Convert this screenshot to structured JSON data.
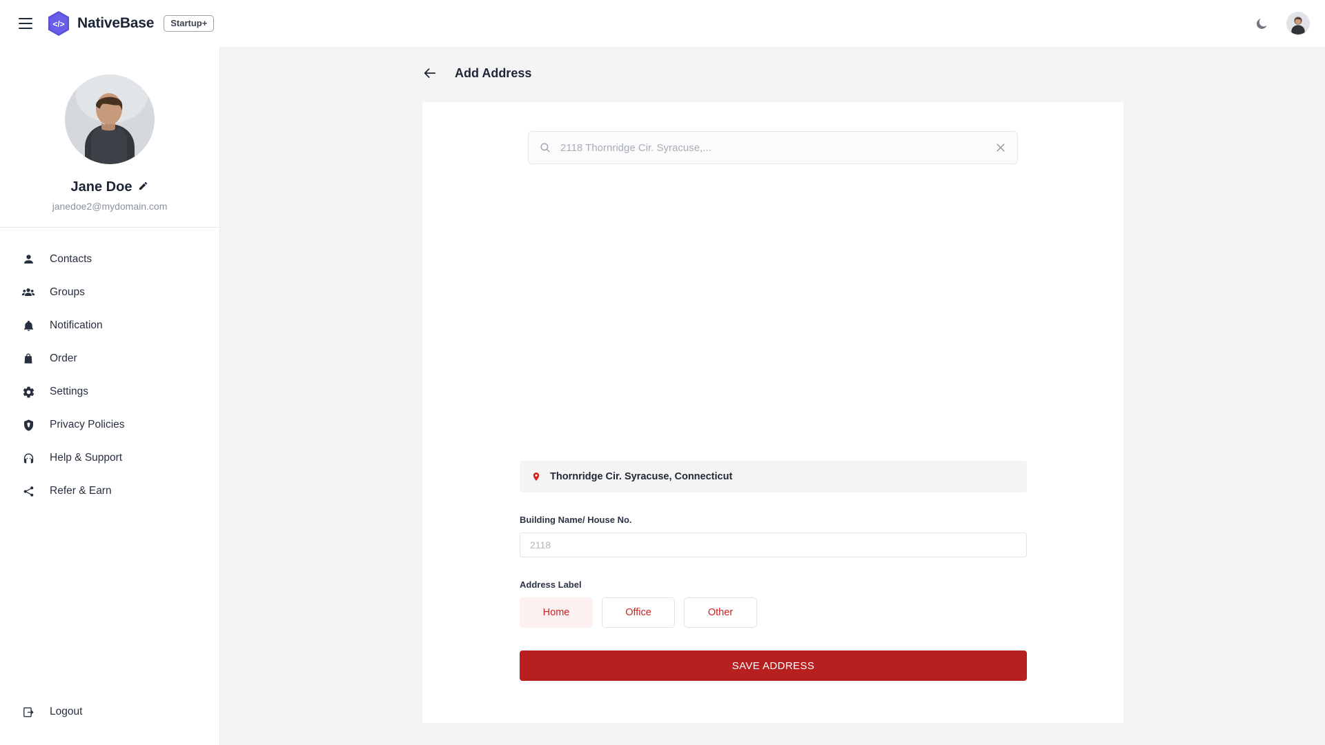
{
  "topbar": {
    "menu_icon": "hamburger-icon",
    "logo_icon": "code-hexagon-logo",
    "brand": "NativeBase",
    "badge": "Startup+",
    "theme_toggle_icon": "moon-icon",
    "avatar_icon": "user-avatar"
  },
  "sidebar": {
    "profile": {
      "avatar_icon": "profile-photo",
      "name": "Jane Doe",
      "edit_icon": "pencil-icon",
      "email": "janedoe2@mydomain.com"
    },
    "items": [
      {
        "label": "Contacts",
        "icon": "person-icon"
      },
      {
        "label": "Groups",
        "icon": "people-group-icon"
      },
      {
        "label": "Notification",
        "icon": "bell-icon"
      },
      {
        "label": "Order",
        "icon": "bag-icon"
      },
      {
        "label": "Settings",
        "icon": "gear-icon"
      },
      {
        "label": "Privacy Policies",
        "icon": "shield-icon"
      },
      {
        "label": "Help & Support",
        "icon": "headset-icon"
      },
      {
        "label": "Refer & Earn",
        "icon": "share-icon"
      }
    ],
    "logout": {
      "label": "Logout",
      "icon": "logout-icon"
    }
  },
  "main": {
    "back_icon": "arrow-left-icon",
    "title": "Add Address",
    "search": {
      "icon": "search-icon",
      "placeholder": "2118 Thornridge Cir. Syracuse,...",
      "value": "",
      "clear_icon": "close-icon"
    },
    "suggestion": {
      "pin_icon": "location-pin-icon",
      "text": "Thornridge Cir. Syracuse, Connecticut"
    },
    "building_field": {
      "label": "Building Name/ House No.",
      "placeholder": "2118",
      "value": ""
    },
    "address_label": {
      "label": "Address Label",
      "options": [
        "Home",
        "Office",
        "Other"
      ],
      "selected": "Home"
    },
    "save_button": "SAVE ADDRESS"
  },
  "colors": {
    "brand_purple": "#5b51d8",
    "accent_red": "#cc2222",
    "save_red": "#b81f1f",
    "chip_selected_bg": "#fdf0f0",
    "page_bg": "#f4f4f4",
    "text_dark": "#1c2536"
  }
}
